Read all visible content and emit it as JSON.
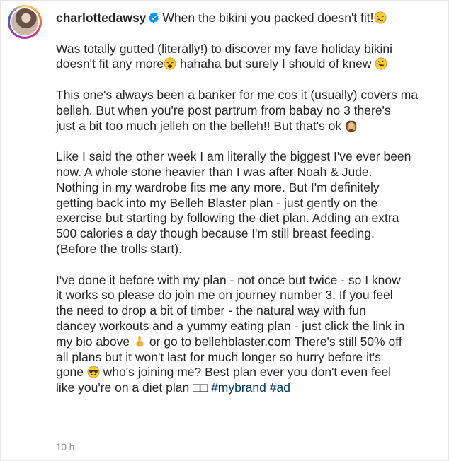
{
  "post": {
    "username": "charlottedawsy",
    "timestamp": "10 h",
    "caption": {
      "title_text": "When the bikini you packed doesn't fit!",
      "p1_a": "Was totally gutted (literally!) to discover my fave holiday bikini",
      "p1_b": "doesn't fit any more",
      "p1_c": " hahaha but surely I should of knew ",
      "p2_a": "This one's always been a banker for me cos it (usually) covers ma",
      "p2_b": "belleh. But when you're post partrum from babay no 3 there's",
      "p2_c": "just a bit too much jelleh on the belleh!! But that's ok ",
      "p3_a": "Like I said the other week I am literally the biggest I've ever been",
      "p3_b": "now. A whole stone heavier than I was after Noah & Jude.",
      "p3_c": "Nothing in my wardrobe fits me any more. But I'm definitely",
      "p3_d": "getting back into my Belleh Blaster plan - just gently on the",
      "p3_e": "exercise but starting by following the diet plan. Adding an extra",
      "p3_f": "500 calories a day though because I'm still breast feeding.",
      "p3_g": "(Before the trolls start).",
      "p4_a": "I've done it before with my plan - not once but twice - so I know",
      "p4_b": "it works so please do join me on journey number 3. If you feel",
      "p4_c": "the need to drop a bit of timber - the natural way with fun",
      "p4_d": "dancey workouts and a yummy eating plan - just click the link in",
      "p4_e": "my bio above ",
      "p4_f": " or go to bellehblaster.com There's still 50% off",
      "p4_g": "all plans but it won't last for much longer so hurry before it's",
      "p4_h": "gone ",
      "p4_i": " who's joining me? Best plan ever you don't even feel",
      "p4_j": "like you're on a diet plan ",
      "p4_boxes": "□□",
      "hashtag1": "#mybrand",
      "hashtag2": "#ad"
    },
    "icons": {
      "verified": "verified-badge-icon",
      "emoji1": "woozy-face-emoji",
      "emoji2": "weary-face-emoji",
      "emoji3": "rolling-laughing-emoji",
      "emoji4": "face-with-hands-emoji",
      "emoji5": "pointing-up-emoji",
      "emoji6": "cool-face-emoji"
    },
    "colors": {
      "verified": "#0095f6",
      "hashtag": "#00376b",
      "timestamp": "#8e8e8e"
    }
  }
}
